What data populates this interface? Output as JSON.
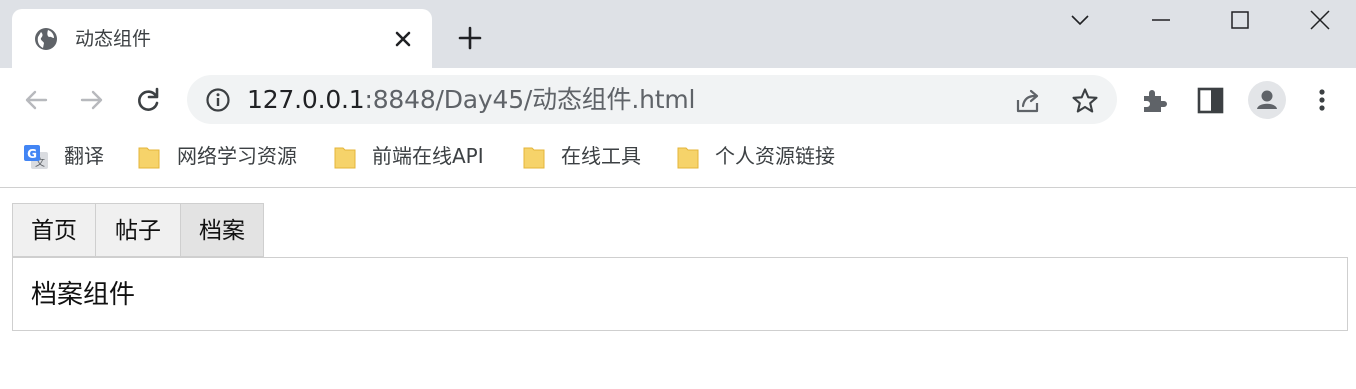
{
  "browser": {
    "tab": {
      "title": "动态组件",
      "favicon": "globe-icon",
      "close_icon": "close-icon"
    },
    "new_tab_icon": "plus-icon",
    "window_controls": [
      "chevron-down-icon",
      "minimize-icon",
      "maximize-icon",
      "close-window-icon"
    ],
    "address_bar": {
      "host": "127.0.0.1",
      "rest": ":8848/Day45/动态组件.html",
      "info_icon": "info-icon",
      "share_icon": "share-icon",
      "bookmark_icon": "star-icon"
    },
    "toolbar_icons": [
      "extensions-icon",
      "side-panel-icon",
      "profile-icon",
      "menu-icon"
    ],
    "bookmarks": [
      {
        "label": "翻译",
        "icon": "google-translate-icon"
      },
      {
        "label": "网络学习资源",
        "icon": "folder-icon"
      },
      {
        "label": "前端在线API",
        "icon": "folder-icon"
      },
      {
        "label": "在线工具",
        "icon": "folder-icon"
      },
      {
        "label": "个人资源链接",
        "icon": "folder-icon"
      }
    ]
  },
  "page": {
    "tabs": [
      {
        "label": "首页",
        "active": false
      },
      {
        "label": "帖子",
        "active": false
      },
      {
        "label": "档案",
        "active": true
      }
    ],
    "content_text": "档案组件"
  },
  "colors": {
    "tabstrip_bg": "#dee1e6",
    "omnibox_bg": "#f1f3f4",
    "folder_yellow": "#f6d36a",
    "active_tab_bg": "#e3e3e3"
  }
}
